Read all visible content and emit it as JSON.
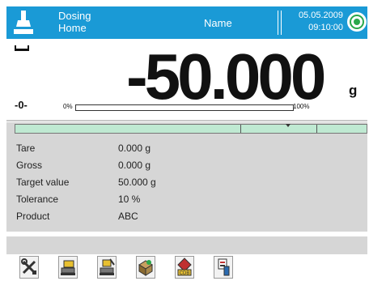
{
  "header": {
    "mode_line1": "Dosing",
    "mode_line2": "Home",
    "user_name": "Name",
    "date": "05.05.2009",
    "time": "09:10:00"
  },
  "readout": {
    "value": "-50.000",
    "unit": "g",
    "zero_indicator": "-0-",
    "bar_min": "0%",
    "bar_max": "100%",
    "progress": 0
  },
  "info": [
    {
      "label": "Tare",
      "value": "0.000  g"
    },
    {
      "label": "Gross",
      "value": "0.000  g"
    },
    {
      "label": "Target value",
      "value": "50.000  g"
    },
    {
      "label": "Tolerance",
      "value": "10 %"
    },
    {
      "label": "Product",
      "value": "ABC"
    }
  ],
  "toolbar": {
    "buttons": [
      {
        "icon": "tools-icon"
      },
      {
        "icon": "weighing-icon"
      },
      {
        "icon": "tare-edit-icon"
      },
      {
        "icon": "product-database-icon"
      },
      {
        "icon": "cdb-database-icon"
      },
      {
        "icon": "print-report-icon"
      }
    ]
  },
  "colors": {
    "header_bg": "#1a9ad6",
    "panel_bg": "#d6d6d6",
    "threshold_bar": "#bfe9d2"
  }
}
